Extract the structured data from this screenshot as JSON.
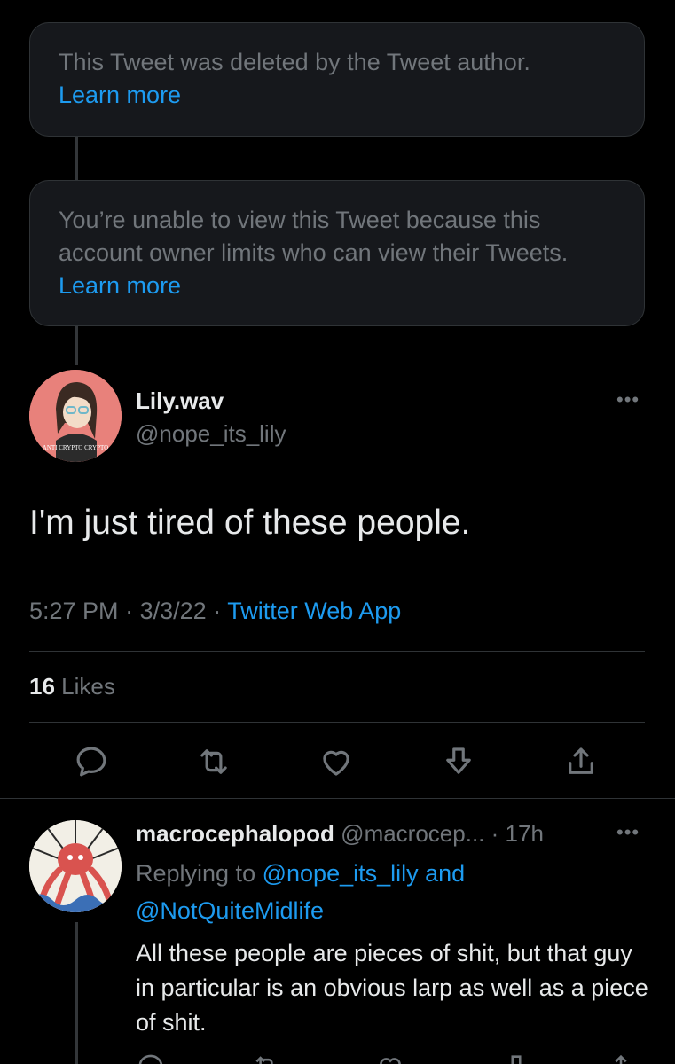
{
  "deleted_notice": {
    "text": "This Tweet was deleted by the Tweet author.",
    "link": "Learn more"
  },
  "restricted_notice": {
    "text": "You’re unable to view this Tweet because this account owner limits who can view their Tweets.",
    "link": "Learn more"
  },
  "main_tweet": {
    "display_name": "Lily.wav",
    "handle": "@nope_its_lily",
    "avatar_text": "ANTI CRYPTO CRYPTO",
    "text": "I'm just tired of these people.",
    "time": "5:27 PM",
    "date": "3/3/22",
    "source": "Twitter Web App",
    "likes_count": "16",
    "likes_label": "Likes"
  },
  "reply": {
    "display_name": "macrocephalopod",
    "handle": "@macrocep...",
    "age": "· 17h",
    "replying_prefix": "Replying to",
    "replying_to_1": "@nope_its_lily",
    "replying_and": "and",
    "replying_to_2": "@NotQuiteMidlife",
    "text": "All these people are pieces of shit, but that guy in particular is an obvious larp as well as a piece of shit."
  },
  "colors": {
    "background": "#000000",
    "link": "#1d9bf0",
    "muted": "#71767b",
    "text": "#e7e9ea"
  }
}
